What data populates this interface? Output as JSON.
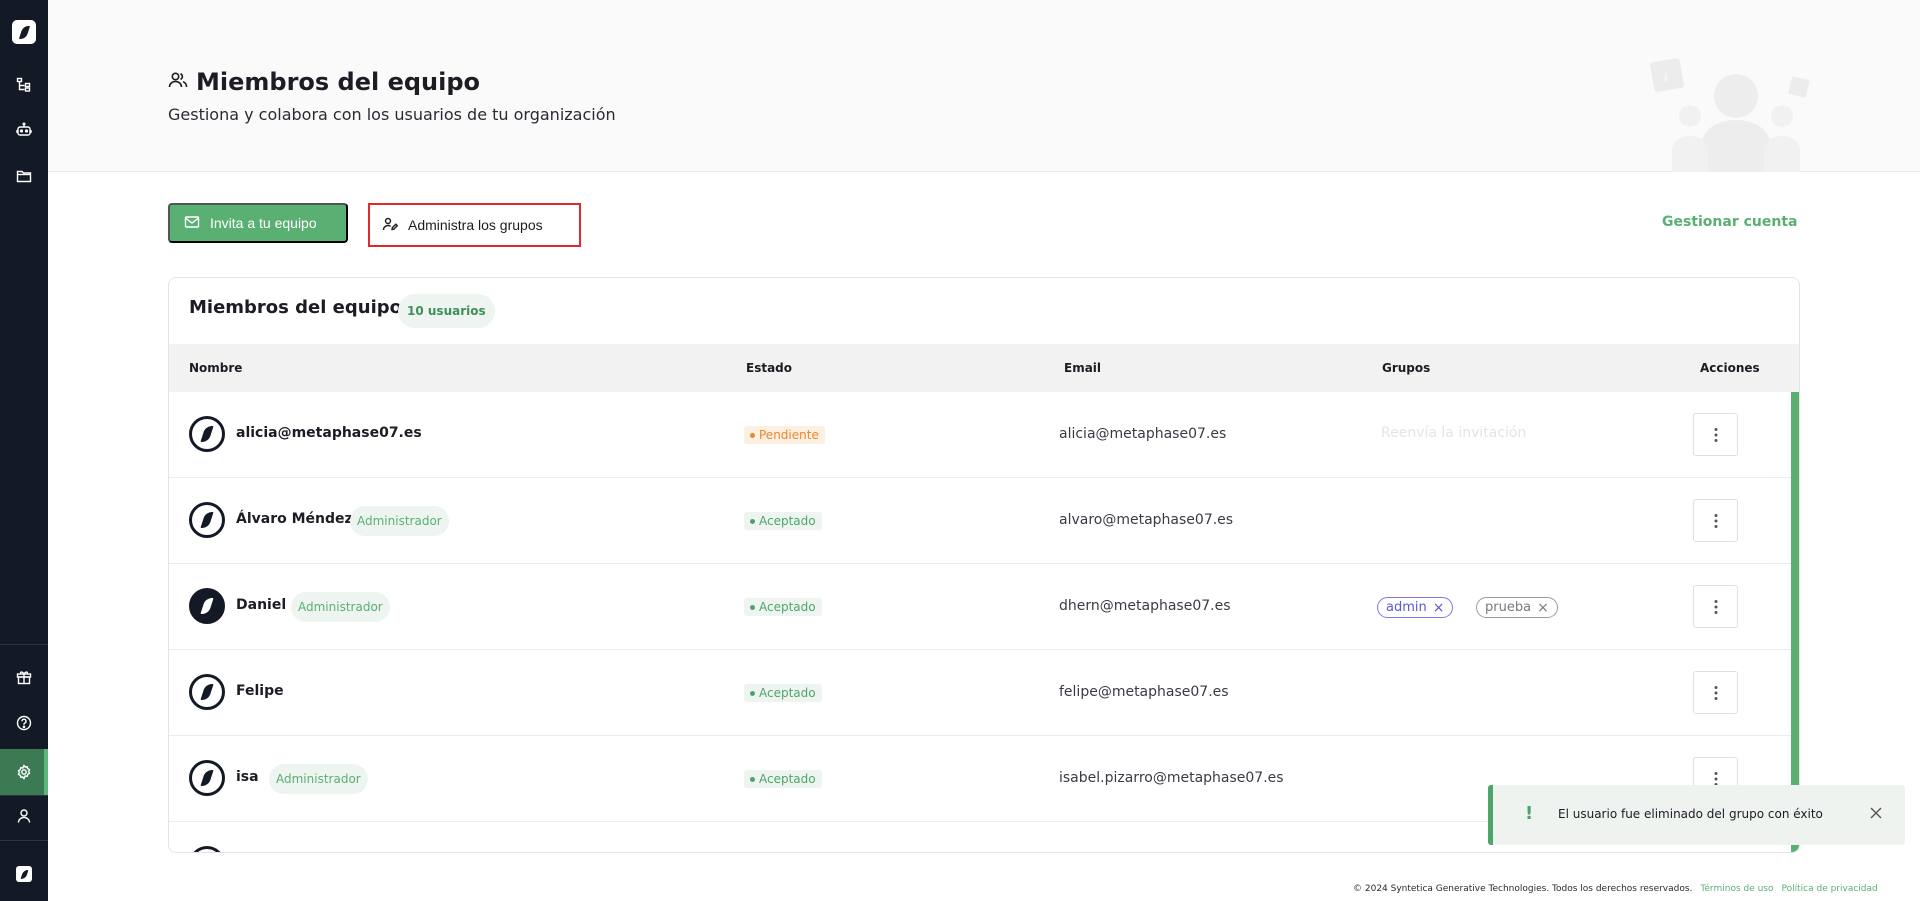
{
  "header": {
    "title": "Miembros del equipo",
    "subtitle": "Gestiona y colabora con los usuarios de tu organización"
  },
  "actions": {
    "invite_label": "Invita a tu equipo",
    "groups_label": "Administra los grupos",
    "account_label": "Gestionar cuenta"
  },
  "card": {
    "title": "Miembros del equipo",
    "count": "10 usuarios"
  },
  "table": {
    "columns": {
      "name": "Nombre",
      "status": "Estado",
      "email": "Email",
      "groups": "Grupos",
      "actions": "Acciones"
    },
    "rows": [
      {
        "name": "alicia@metaphase07.es",
        "admin": "",
        "status": "Pendiente",
        "email": "alicia@metaphase07.es",
        "resend": "Reenvía la invitación",
        "groups": []
      },
      {
        "name": "Álvaro Méndez",
        "admin": "Administrador",
        "status": "Aceptado",
        "email": "alvaro@metaphase07.es",
        "resend": "",
        "groups": []
      },
      {
        "name": "Daniel",
        "admin": "Administrador",
        "status": "Aceptado",
        "email": "dhern@metaphase07.es",
        "resend": "",
        "groups": [
          "admin",
          "prueba"
        ]
      },
      {
        "name": "Felipe",
        "admin": "",
        "status": "Aceptado",
        "email": "felipe@metaphase07.es",
        "resend": "",
        "groups": []
      },
      {
        "name": "isa",
        "admin": "Administrador",
        "status": "Aceptado",
        "email": "isabel.pizarro@metaphase07.es",
        "resend": "",
        "groups": []
      }
    ]
  },
  "toast": {
    "message": "El usuario fue eliminado del grupo con éxito",
    "icon": "!"
  },
  "footer": {
    "copyright": "© 2024 Syntetica Generative Technologies. Todos los derechos reservados.",
    "terms": "Términos de uso",
    "privacy": "Política de privacidad"
  },
  "colors": {
    "sidebar": "#131a26",
    "accent": "#5aaf73",
    "pending": "#e8872e",
    "highlight": "#e02a2a"
  },
  "icons": {
    "sidebar_top": [
      "app-logo-icon",
      "flow-icon",
      "robot-icon",
      "folder-icon"
    ],
    "sidebar_bottom": [
      "gift-icon",
      "help-icon",
      "settings-icon",
      "user-icon",
      "app-logo-icon"
    ]
  }
}
